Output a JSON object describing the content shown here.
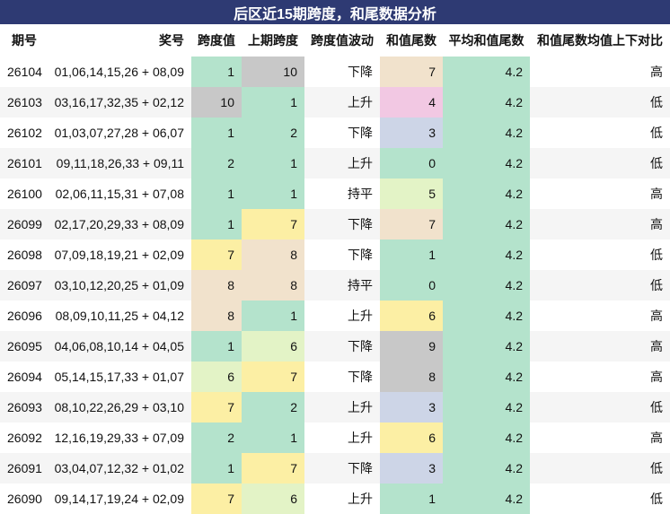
{
  "title": "后区近15期跨度，和尾数据分析",
  "columns": [
    "期号",
    "奖号",
    "跨度值",
    "上期跨度",
    "跨度值波动",
    "和值尾数",
    "平均和值尾数",
    "和值尾数均值上下对比"
  ],
  "colors": {
    "mint": "#b4e3cc",
    "gray": "#c8c8c8",
    "peach": "#f1e2cc",
    "pink": "#f2c8e3",
    "lavender": "#cdd5e7",
    "yellow": "#fcefa4",
    "lightgreen": "#e3f3c6"
  },
  "rows": [
    {
      "issue": "26104",
      "numbers": "01,06,14,15,26 + 08,09",
      "span": "1",
      "span_color": "mint",
      "prev": "10",
      "prev_color": "gray",
      "trend": "下降",
      "tail": "7",
      "tail_color": "peach",
      "avg": "4.2",
      "cmp": "高"
    },
    {
      "issue": "26103",
      "numbers": "03,16,17,32,35 + 02,12",
      "span": "10",
      "span_color": "gray",
      "prev": "1",
      "prev_color": "mint",
      "trend": "上升",
      "tail": "4",
      "tail_color": "pink",
      "avg": "4.2",
      "cmp": "低"
    },
    {
      "issue": "26102",
      "numbers": "01,03,07,27,28 + 06,07",
      "span": "1",
      "span_color": "mint",
      "prev": "2",
      "prev_color": "mint",
      "trend": "下降",
      "tail": "3",
      "tail_color": "lavender",
      "avg": "4.2",
      "cmp": "低"
    },
    {
      "issue": "26101",
      "numbers": "09,11,18,26,33 + 09,11",
      "span": "2",
      "span_color": "mint",
      "prev": "1",
      "prev_color": "mint",
      "trend": "上升",
      "tail": "0",
      "tail_color": "mint",
      "avg": "4.2",
      "cmp": "低"
    },
    {
      "issue": "26100",
      "numbers": "02,06,11,15,31 + 07,08",
      "span": "1",
      "span_color": "mint",
      "prev": "1",
      "prev_color": "mint",
      "trend": "持平",
      "tail": "5",
      "tail_color": "lightgreen",
      "avg": "4.2",
      "cmp": "高"
    },
    {
      "issue": "26099",
      "numbers": "02,17,20,29,33 + 08,09",
      "span": "1",
      "span_color": "mint",
      "prev": "7",
      "prev_color": "yellow",
      "trend": "下降",
      "tail": "7",
      "tail_color": "peach",
      "avg": "4.2",
      "cmp": "高"
    },
    {
      "issue": "26098",
      "numbers": "07,09,18,19,21 + 02,09",
      "span": "7",
      "span_color": "yellow",
      "prev": "8",
      "prev_color": "peach",
      "trend": "下降",
      "tail": "1",
      "tail_color": "mint",
      "avg": "4.2",
      "cmp": "低"
    },
    {
      "issue": "26097",
      "numbers": "03,10,12,20,25 + 01,09",
      "span": "8",
      "span_color": "peach",
      "prev": "8",
      "prev_color": "peach",
      "trend": "持平",
      "tail": "0",
      "tail_color": "mint",
      "avg": "4.2",
      "cmp": "低"
    },
    {
      "issue": "26096",
      "numbers": "08,09,10,11,25 + 04,12",
      "span": "8",
      "span_color": "peach",
      "prev": "1",
      "prev_color": "mint",
      "trend": "上升",
      "tail": "6",
      "tail_color": "yellow",
      "avg": "4.2",
      "cmp": "高"
    },
    {
      "issue": "26095",
      "numbers": "04,06,08,10,14 + 04,05",
      "span": "1",
      "span_color": "mint",
      "prev": "6",
      "prev_color": "lightgreen",
      "trend": "下降",
      "tail": "9",
      "tail_color": "gray",
      "avg": "4.2",
      "cmp": "高"
    },
    {
      "issue": "26094",
      "numbers": "05,14,15,17,33 + 01,07",
      "span": "6",
      "span_color": "lightgreen",
      "prev": "7",
      "prev_color": "yellow",
      "trend": "下降",
      "tail": "8",
      "tail_color": "gray",
      "avg": "4.2",
      "cmp": "高"
    },
    {
      "issue": "26093",
      "numbers": "08,10,22,26,29 + 03,10",
      "span": "7",
      "span_color": "yellow",
      "prev": "2",
      "prev_color": "mint",
      "trend": "上升",
      "tail": "3",
      "tail_color": "lavender",
      "avg": "4.2",
      "cmp": "低"
    },
    {
      "issue": "26092",
      "numbers": "12,16,19,29,33 + 07,09",
      "span": "2",
      "span_color": "mint",
      "prev": "1",
      "prev_color": "mint",
      "trend": "上升",
      "tail": "6",
      "tail_color": "yellow",
      "avg": "4.2",
      "cmp": "高"
    },
    {
      "issue": "26091",
      "numbers": "03,04,07,12,32 + 01,02",
      "span": "1",
      "span_color": "mint",
      "prev": "7",
      "prev_color": "yellow",
      "trend": "下降",
      "tail": "3",
      "tail_color": "lavender",
      "avg": "4.2",
      "cmp": "低"
    },
    {
      "issue": "26090",
      "numbers": "09,14,17,19,24 + 02,09",
      "span": "7",
      "span_color": "yellow",
      "prev": "6",
      "prev_color": "lightgreen",
      "trend": "上升",
      "tail": "1",
      "tail_color": "mint",
      "avg": "4.2",
      "cmp": "低"
    }
  ]
}
